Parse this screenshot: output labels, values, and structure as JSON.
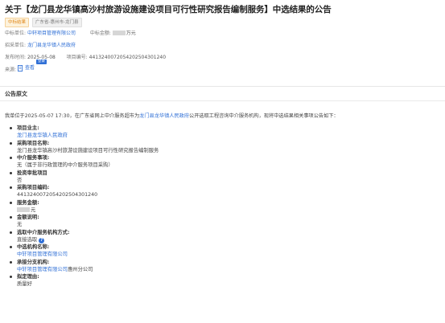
{
  "title": "关于【龙门县龙华镇高沙村旅游设施建设项目可行性研究报告编制服务】中选结果的公告",
  "tags": {
    "status": "中标结果",
    "region": "广东省-惠州市-龙门县"
  },
  "meta": {
    "winner_label": "中标单位:",
    "winner_value": "中轩项目管理有限公司",
    "amount_label": "中标金额:",
    "amount_unit": "万元",
    "tenderer_label": "招采单位:",
    "tenderer_value": "龙门县龙华镇人民政府",
    "date_label": "发布时间:",
    "date_value": "2025-05-08",
    "project_no_label": "项目编号:",
    "project_no_value": "4413240072054202504301240",
    "source_label": "来源:",
    "source_link": "查看",
    "badge": "登录"
  },
  "section_title": "公告原文",
  "intro": {
    "prefix": "我单位于2025-05-07 17:30，在广东省网上中介服务超市为",
    "link": "龙门县龙华镇人民政府",
    "suffix": "公开选取工程咨询中介服务机构，现将中选结果相关事项公告如下："
  },
  "fields": [
    {
      "label": "项目业主:",
      "value": "龙门县龙华镇人民政府",
      "link": true
    },
    {
      "label": "采购项目名称:",
      "value": "龙门县龙华镇高沙村旅游设施建设项目可行性研究报告编制服务"
    },
    {
      "label": "中介服务事项:",
      "value": "无（属于非行政管理的中介服务项目采购）"
    },
    {
      "label": "投资审批项目",
      "value": "否"
    },
    {
      "label": "采购项目编码:",
      "value": "4413240072054202504301240"
    },
    {
      "label": "服务金额:",
      "value": "元",
      "masked": true
    },
    {
      "label": "金额说明:",
      "value": "无"
    },
    {
      "label": "选取中介服务机构方式:",
      "value": "直接选取",
      "help": true
    },
    {
      "label": "中选机构名称:",
      "value": "中轩项目管理有限公司",
      "link": true
    },
    {
      "label": "承接分支机构:",
      "value": "中轩项目管理有限公司",
      "link": true,
      "suffix": "惠州分公司"
    },
    {
      "label": "拟定理由:",
      "value": "质量好"
    }
  ],
  "colors": {
    "link": "#2f6fd6",
    "status_tag": "#e08a1e"
  }
}
